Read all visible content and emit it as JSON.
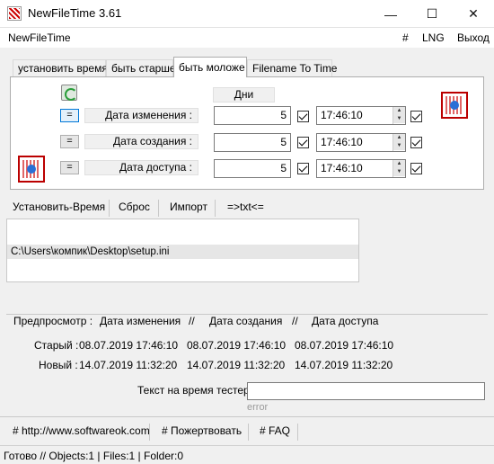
{
  "window": {
    "title": "NewFileTime 3.61",
    "minimize": "—",
    "maximize": "☐",
    "close": "✕"
  },
  "menu": {
    "app": "NewFileTime",
    "hash": "#",
    "lng": "LNG",
    "exit": "Выход"
  },
  "tabs": [
    "установить время",
    "быть старше",
    "быть моложе",
    "Filename To Time"
  ],
  "active_tab": 2,
  "panel": {
    "days_header": "Дни",
    "rows": [
      {
        "eq": "=",
        "label": "Дата изменения :",
        "days": "5",
        "time": "17:46:10"
      },
      {
        "eq": "=",
        "label": "Дата создания :",
        "days": "5",
        "time": "17:46:10"
      },
      {
        "eq": "=",
        "label": "Дата доступа :",
        "days": "5",
        "time": "17:46:10"
      }
    ]
  },
  "actions": {
    "set_time": "Установить-Время",
    "reset": "Сброс",
    "import": "Импорт",
    "txt": "=>txt<="
  },
  "files": [
    "C:\\Users\\компик\\Desktop\\setup.ini"
  ],
  "preview": {
    "header": [
      "Предпросмотр :",
      "Дата изменения",
      "//",
      "Дата создания",
      "//",
      "Дата доступа"
    ],
    "old_label": "Старый :",
    "new_label": "Новый :",
    "old": [
      "08.07.2019 17:46:10",
      "08.07.2019 17:46:10",
      "08.07.2019 17:46:10"
    ],
    "new": [
      "14.07.2019 11:32:20",
      "14.07.2019 11:32:20",
      "14.07.2019 11:32:20"
    ]
  },
  "tester": {
    "label": "Текст на время тестер",
    "value": "",
    "error": "error"
  },
  "links": {
    "site": "# http://www.softwareok.com",
    "donate": "# Пожертвовать",
    "faq": "# FAQ"
  },
  "status": "Готово // Objects:1 | Files:1  | Folder:0"
}
